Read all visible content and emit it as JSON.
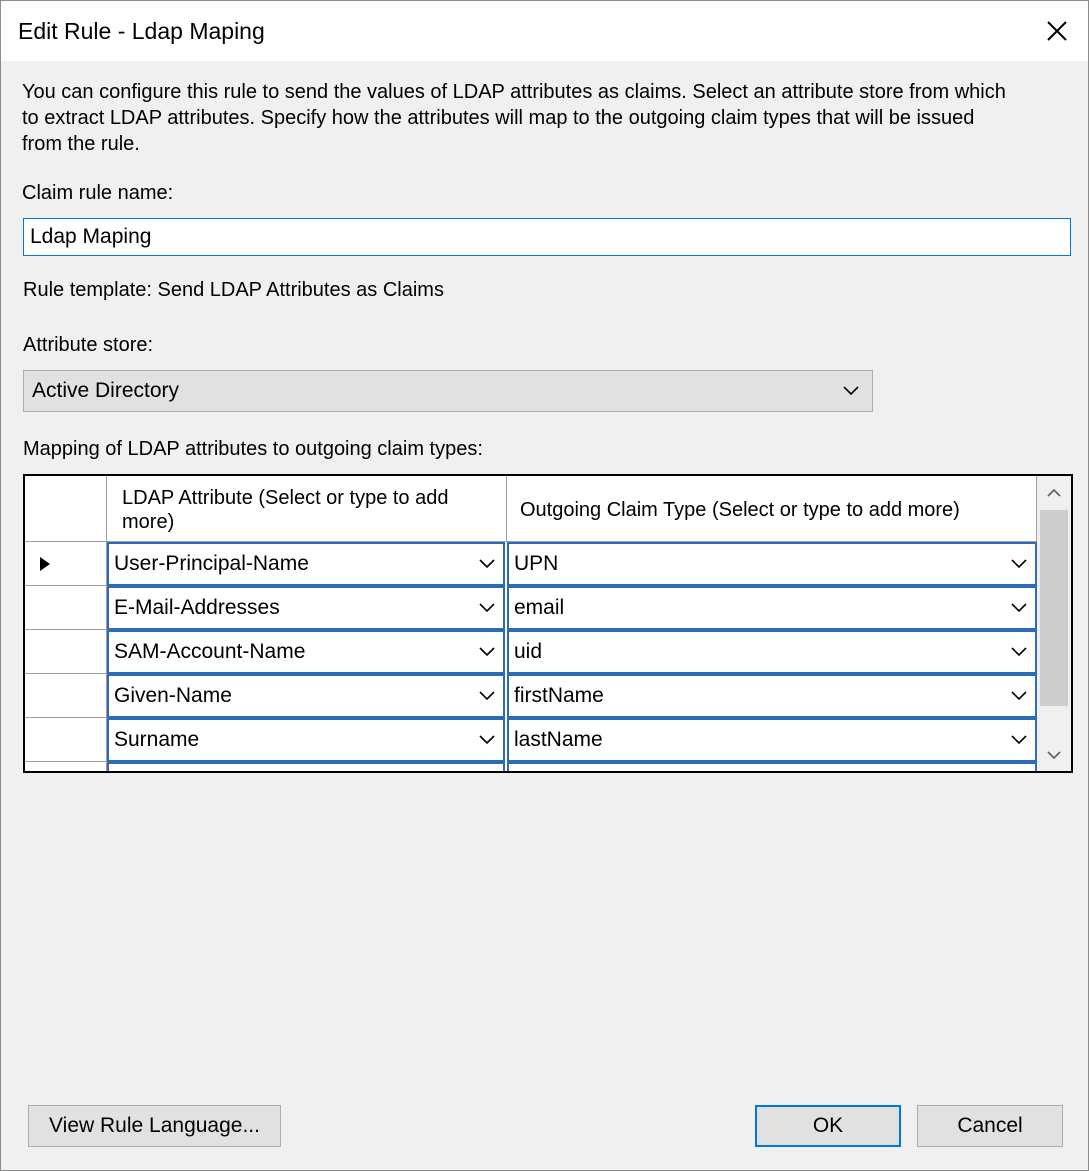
{
  "window": {
    "title": "Edit Rule - Ldap Maping"
  },
  "description": "You can configure this rule to send the values of LDAP attributes as claims. Select an attribute store from which\nto extract LDAP attributes. Specify how the attributes will map to the outgoing claim types that will be issued\nfrom the rule.",
  "rule_name": {
    "label": "Claim rule name:",
    "value": "Ldap Maping"
  },
  "rule_template": "Rule template: Send LDAP Attributes as Claims",
  "attribute_store": {
    "label": "Attribute store:",
    "value": "Active Directory"
  },
  "mapping": {
    "label": "Mapping of LDAP attributes to outgoing claim types:",
    "columns": [
      "LDAP Attribute (Select or type to add more)",
      "Outgoing Claim Type (Select or type to add more)"
    ],
    "rows": [
      {
        "ldap": "User-Principal-Name",
        "claim": "UPN"
      },
      {
        "ldap": "E-Mail-Addresses",
        "claim": "email"
      },
      {
        "ldap": "SAM-Account-Name",
        "claim": "uid"
      },
      {
        "ldap": "Given-Name",
        "claim": "firstName"
      },
      {
        "ldap": "Surname",
        "claim": "lastName"
      }
    ]
  },
  "buttons": {
    "view_rule_language": "View Rule Language...",
    "ok": "OK",
    "cancel": "Cancel"
  },
  "icons": [
    "close-icon",
    "chevron-down-icon",
    "row-pointer-icon",
    "scroll-up-icon",
    "scroll-down-icon"
  ],
  "colors": {
    "accent": "#0078d7",
    "cell_border": "#2d6bb8",
    "button_bg": "#e1e1e1"
  }
}
